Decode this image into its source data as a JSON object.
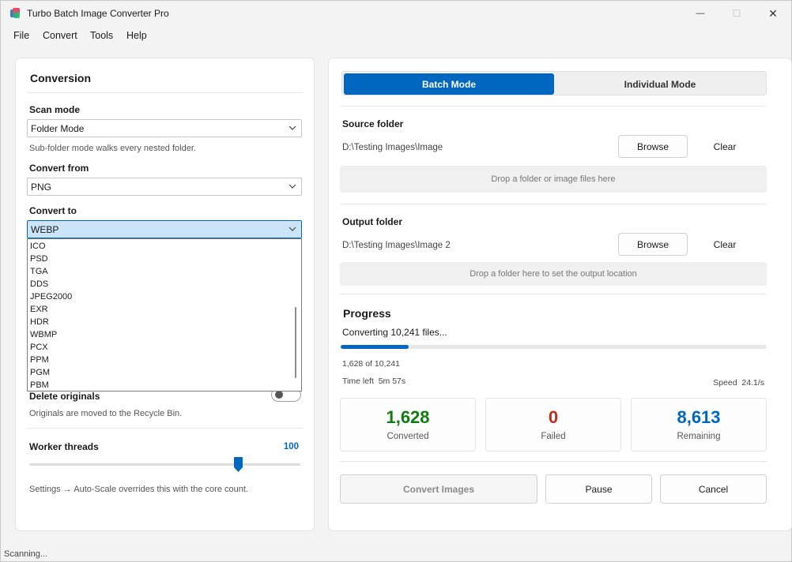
{
  "window": {
    "title": "Turbo Batch Image Converter Pro",
    "controls": {
      "minimize": "—",
      "maximize": "☐",
      "close": "✕"
    }
  },
  "menu": [
    "File",
    "Convert",
    "Tools",
    "Help"
  ],
  "conversion": {
    "heading": "Conversion",
    "scan_mode": {
      "label": "Scan mode",
      "value": "Folder Mode",
      "hint": "Sub-folder mode walks every nested folder."
    },
    "convert_from": {
      "label": "Convert from",
      "value": "PNG"
    },
    "convert_to": {
      "label": "Convert to",
      "value": "WEBP",
      "options": [
        "ICO",
        "PSD",
        "TGA",
        "DDS",
        "JPEG2000",
        "EXR",
        "HDR",
        "WBMP",
        "PCX",
        "PPM",
        "PGM",
        "PBM"
      ]
    },
    "delete_originals": {
      "label": "Delete originals",
      "hint": "Originals are moved to the Recycle Bin.",
      "enabled": false
    },
    "worker_threads": {
      "label": "Worker threads",
      "value": "100",
      "hint": "Settings → Auto-Scale overrides this with the core count."
    }
  },
  "modes": {
    "batch": "Batch Mode",
    "individual": "Individual Mode",
    "selected": "batch"
  },
  "source": {
    "label": "Source folder",
    "path": "D:\\Testing Images\\Image",
    "browse": "Browse",
    "clear": "Clear",
    "drop_hint": "Drop a folder or image files here"
  },
  "output": {
    "label": "Output folder",
    "path": "D:\\Testing Images\\Image 2",
    "browse": "Browse",
    "clear": "Clear",
    "drop_hint": "Drop a folder here to set the output location"
  },
  "progress": {
    "heading": "Progress",
    "status": "Converting 10,241 files...",
    "fraction": 0.159,
    "count": "1,628 of 10,241",
    "time_left_label": "Time left",
    "time_left": "5m 57s",
    "speed_label": "Speed",
    "speed": "24.1/s"
  },
  "stats": {
    "converted": {
      "value": "1,628",
      "label": "Converted",
      "color": "#107c10"
    },
    "failed": {
      "value": "0",
      "label": "Failed",
      "color": "#c42b1c"
    },
    "remaining": {
      "value": "8,613",
      "label": "Remaining",
      "color": "#0067c0"
    }
  },
  "actions": {
    "convert": "Convert Images",
    "pause": "Pause",
    "cancel": "Cancel"
  },
  "status_bar": "Scanning..."
}
